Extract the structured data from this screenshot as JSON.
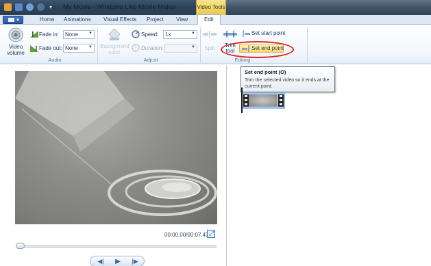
{
  "window": {
    "title": "My Movie - Windows Live Movie Maker",
    "context_tab_group": "Video Tools"
  },
  "tabs": [
    {
      "label": "Home"
    },
    {
      "label": "Animations"
    },
    {
      "label": "Visual Effects"
    },
    {
      "label": "Project"
    },
    {
      "label": "View"
    },
    {
      "label": "Edit",
      "active": true
    }
  ],
  "ribbon": {
    "audio": {
      "label": "Audio",
      "video_volume": "Video volume",
      "fade_in_label": "Fade in:",
      "fade_in_value": "None",
      "fade_out_label": "Fade out:",
      "fade_out_value": "None"
    },
    "adjust": {
      "label": "Adjust",
      "background_color": "Background color",
      "speed_label": "Speed:",
      "speed_value": "1x",
      "duration_label": "Duration:",
      "duration_value": ""
    },
    "editing": {
      "label": "Editing",
      "split": "Split",
      "trim_tool": "Trim tool",
      "set_start_point": "Set start point",
      "set_end_point": "Set end point"
    }
  },
  "preview": {
    "timecode": "00:00.00/00:07.47",
    "seek_position": 0
  },
  "tooltip": {
    "title": "Set end point (O)",
    "body": "Trim the selected video so it ends at the current point."
  },
  "icons": [
    "app-menu-icon",
    "save-icon",
    "undo-icon",
    "redo-icon",
    "video-volume-icon",
    "fade-in-icon",
    "fade-out-icon",
    "background-color-icon",
    "speed-icon",
    "duration-icon",
    "split-icon",
    "trim-tool-icon",
    "set-start-point-icon",
    "set-end-point-icon",
    "fullscreen-icon",
    "previous-frame-icon",
    "play-icon",
    "next-frame-icon"
  ],
  "colors": {
    "accent": "#2f6fb7",
    "context_tab": "#eac851",
    "highlight_ring": "#e02020"
  }
}
